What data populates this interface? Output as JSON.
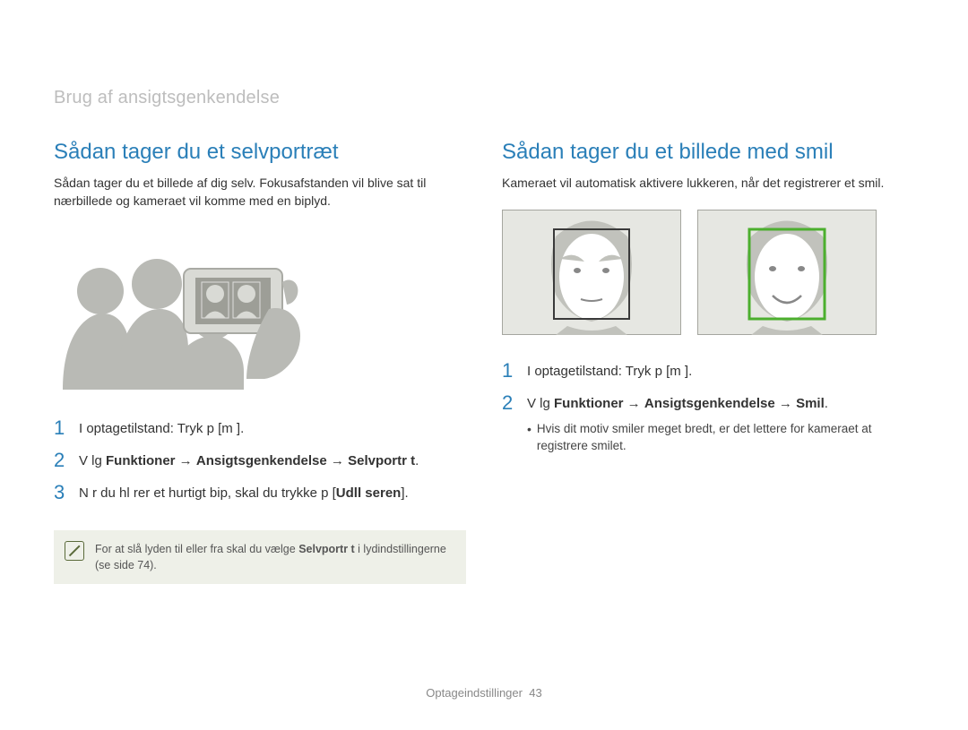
{
  "breadcrumb": "Brug af ansigtsgenkendelse",
  "left": {
    "title": "Sådan tager du et selvportræt",
    "intro": "Sådan tager du et billede af dig selv. Fokusafstanden vil blive sat til nærbillede og kameraet vil komme med en biplyd.",
    "steps": {
      "s1_num": "1",
      "s1_txt": "I optagetilstand: Tryk p   [m       ].",
      "s2_num": "2",
      "s2_prefix": "V  lg ",
      "s2_bold1": "Funktioner",
      "s2_arrow1": " → ",
      "s2_bold2": "Ansigtsgenkendelse",
      "s2_arrow2": " → ",
      "s2_bold3": "Selvportr t",
      "s2_tail": ".",
      "s3_num": "3",
      "s3_prefix": "N  r du hl rer et hurtigt bip, skal du trykke p  [",
      "s3_bold": "Udll seren",
      "s3_tail": "]."
    },
    "note_prefix": "For at slå lyden til eller fra skal du vælge ",
    "note_bold": "Selvportr t",
    "note_suffix": " i lydindstillingerne (se side 74)."
  },
  "right": {
    "title": "Sådan tager du et billede med smil",
    "intro": "Kameraet vil automatisk aktivere lukkeren, når det registrerer et smil.",
    "steps": {
      "s1_num": "1",
      "s1_txt": "I optagetilstand: Tryk p   [m       ].",
      "s2_num": "2",
      "s2_prefix": "V  lg ",
      "s2_bold1": "Funktioner",
      "s2_arrow1": " → ",
      "s2_bold2": "Ansigtsgenkendelse",
      "s2_arrow2": " → ",
      "s2_bold3": "Smil",
      "s2_tail": "."
    },
    "bullet": "Hvis dit motiv smiler meget bredt, er det lettere for kameraet at registrere smilet."
  },
  "footer_label": "Optageindstillinger",
  "footer_page": "43"
}
